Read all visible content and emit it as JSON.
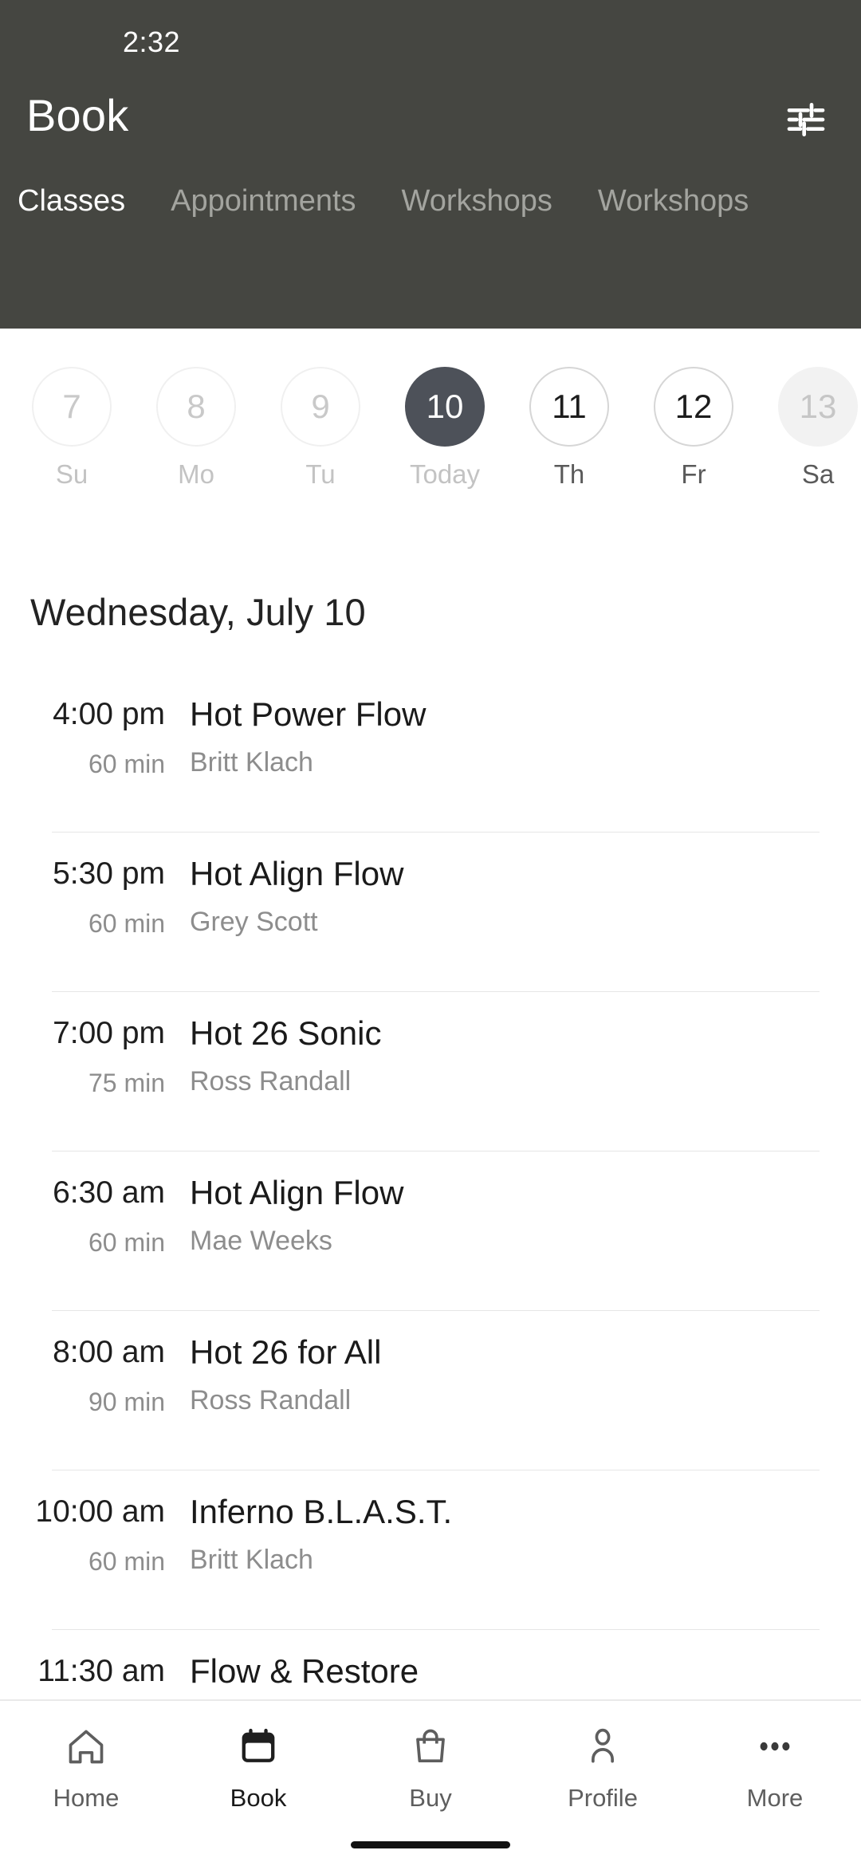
{
  "statusbar": {
    "time": "2:32"
  },
  "header": {
    "title": "Book",
    "background_color": "#454641",
    "filter_icon": "tune-filter-icon"
  },
  "tabs": [
    {
      "label": "Classes",
      "active": true
    },
    {
      "label": "Appointments",
      "active": false
    },
    {
      "label": "Workshops",
      "active": false
    },
    {
      "label": "Workshops",
      "active": false
    }
  ],
  "date_strip": [
    {
      "day": "7",
      "weekday": "Su",
      "state": "past"
    },
    {
      "day": "8",
      "weekday": "Mo",
      "state": "past"
    },
    {
      "day": "9",
      "weekday": "Tu",
      "state": "past"
    },
    {
      "day": "10",
      "weekday": "Today",
      "state": "selected"
    },
    {
      "day": "11",
      "weekday": "Th",
      "state": "future"
    },
    {
      "day": "12",
      "weekday": "Fr",
      "state": "future"
    },
    {
      "day": "13",
      "weekday": "Sa",
      "state": "disabled"
    }
  ],
  "selected_date_heading": "Wednesday, July 10",
  "classes": [
    {
      "time": "4:00 pm",
      "duration": "60 min",
      "name": "Hot Power Flow",
      "instructor": "Britt Klach"
    },
    {
      "time": "5:30 pm",
      "duration": "60 min",
      "name": "Hot Align Flow",
      "instructor": "Grey Scott"
    },
    {
      "time": "7:00 pm",
      "duration": "75 min",
      "name": "Hot 26 Sonic",
      "instructor": "Ross Randall"
    },
    {
      "time": "6:30 am",
      "duration": "60 min",
      "name": "Hot Align Flow",
      "instructor": "Mae Weeks"
    },
    {
      "time": "8:00 am",
      "duration": "90 min",
      "name": "Hot 26 for All",
      "instructor": "Ross Randall"
    },
    {
      "time": "10:00 am",
      "duration": "60 min",
      "name": "Inferno B.L.A.S.T.",
      "instructor": "Britt Klach"
    },
    {
      "time": "11:30 am",
      "duration": "",
      "name": "Flow & Restore",
      "instructor": ""
    }
  ],
  "bottom_nav": [
    {
      "label": "Home",
      "icon": "home-icon",
      "active": false
    },
    {
      "label": "Book",
      "icon": "calendar-icon",
      "active": true
    },
    {
      "label": "Buy",
      "icon": "bag-icon",
      "active": false
    },
    {
      "label": "Profile",
      "icon": "person-icon",
      "active": false
    },
    {
      "label": "More",
      "icon": "ellipsis-icon",
      "active": false
    }
  ]
}
